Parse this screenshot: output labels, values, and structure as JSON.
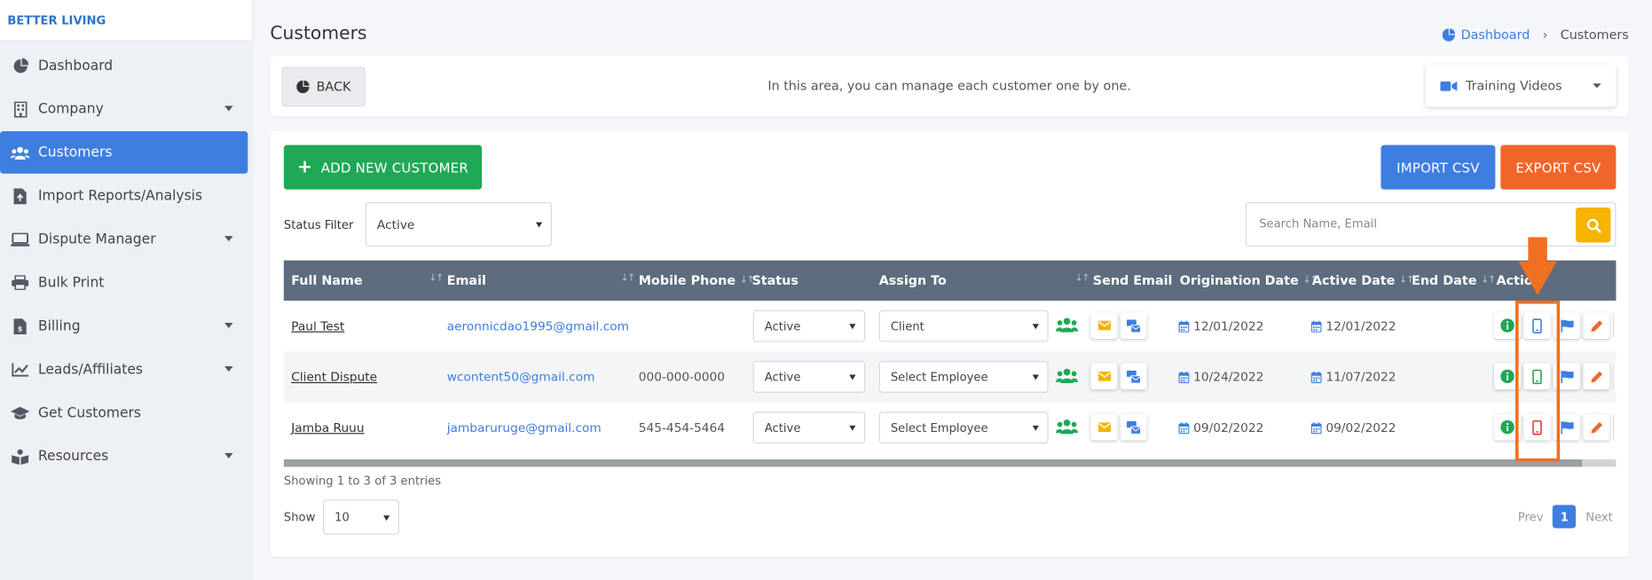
{
  "brand": "BETTER LIVING",
  "sidebar": {
    "items": [
      {
        "label": "Dashboard",
        "icon": "pie-chart-icon",
        "has_caret": false,
        "active": false
      },
      {
        "label": "Company",
        "icon": "building-icon",
        "has_caret": true,
        "active": false
      },
      {
        "label": "Customers",
        "icon": "users-icon",
        "has_caret": false,
        "active": true
      },
      {
        "label": "Import Reports/Analysis",
        "icon": "file-import-icon",
        "has_caret": false,
        "active": false
      },
      {
        "label": "Dispute Manager",
        "icon": "laptop-icon",
        "has_caret": true,
        "active": false
      },
      {
        "label": "Bulk Print",
        "icon": "printer-icon",
        "has_caret": false,
        "active": false
      },
      {
        "label": "Billing",
        "icon": "invoice-icon",
        "has_caret": true,
        "active": false
      },
      {
        "label": "Leads/Affiliates",
        "icon": "chart-line-icon",
        "has_caret": true,
        "active": false
      },
      {
        "label": "Get Customers",
        "icon": "graduation-cap-icon",
        "has_caret": false,
        "active": false
      },
      {
        "label": "Resources",
        "icon": "book-reader-icon",
        "has_caret": true,
        "active": false
      }
    ]
  },
  "header": {
    "title": "Customers",
    "breadcrumb": {
      "home": "Dashboard",
      "current": "Customers"
    }
  },
  "topbar": {
    "back_label": "BACK",
    "info": "In this area, you can manage each customer one by one.",
    "training_label": "Training Videos"
  },
  "toolbar": {
    "add_label": "ADD NEW CUSTOMER",
    "import_label": "IMPORT CSV",
    "export_label": "EXPORT CSV",
    "status_filter_label": "Status Filter",
    "status_filter_value": "Active",
    "search_placeholder": "Search Name, Email"
  },
  "table": {
    "columns": [
      "Full Name",
      "Email",
      "Mobile Phone",
      "Status",
      "Assign To",
      "Send Email",
      "Origination Date",
      "Active Date",
      "End Date",
      "Actio"
    ],
    "rows": [
      {
        "name": "Paul Test",
        "email": "aeronnicdao1995@gmail.com",
        "phone": "",
        "status": "Active",
        "assign": "Client",
        "origination": "12/01/2022",
        "active_date": "12/01/2022",
        "end_date": "",
        "phone_icon_color": "#3d7ee0"
      },
      {
        "name": "Client Dispute",
        "email": "wcontent50@gmail.com",
        "phone": "000-000-0000",
        "status": "Active",
        "assign": "Select Employee",
        "origination": "10/24/2022",
        "active_date": "11/07/2022",
        "end_date": "",
        "phone_icon_color": "#1fa855"
      },
      {
        "name": "Jamba Ruuu",
        "email": "jambaruruge@gmail.com",
        "phone": "545-454-5464",
        "status": "Active",
        "assign": "Select Employee",
        "origination": "09/02/2022",
        "active_date": "09/02/2022",
        "end_date": "",
        "phone_icon_color": "#e53935"
      }
    ]
  },
  "footer": {
    "showing": "Showing 1 to 3 of 3 entries",
    "show_label": "Show",
    "show_value": "10",
    "prev": "Prev",
    "page": "1",
    "next": "Next"
  },
  "colors": {
    "accent": "#3d7ee0",
    "green": "#1fa855",
    "orange": "#f0662a",
    "header_bg": "#5d6c7e",
    "highlight": "#f07021"
  }
}
